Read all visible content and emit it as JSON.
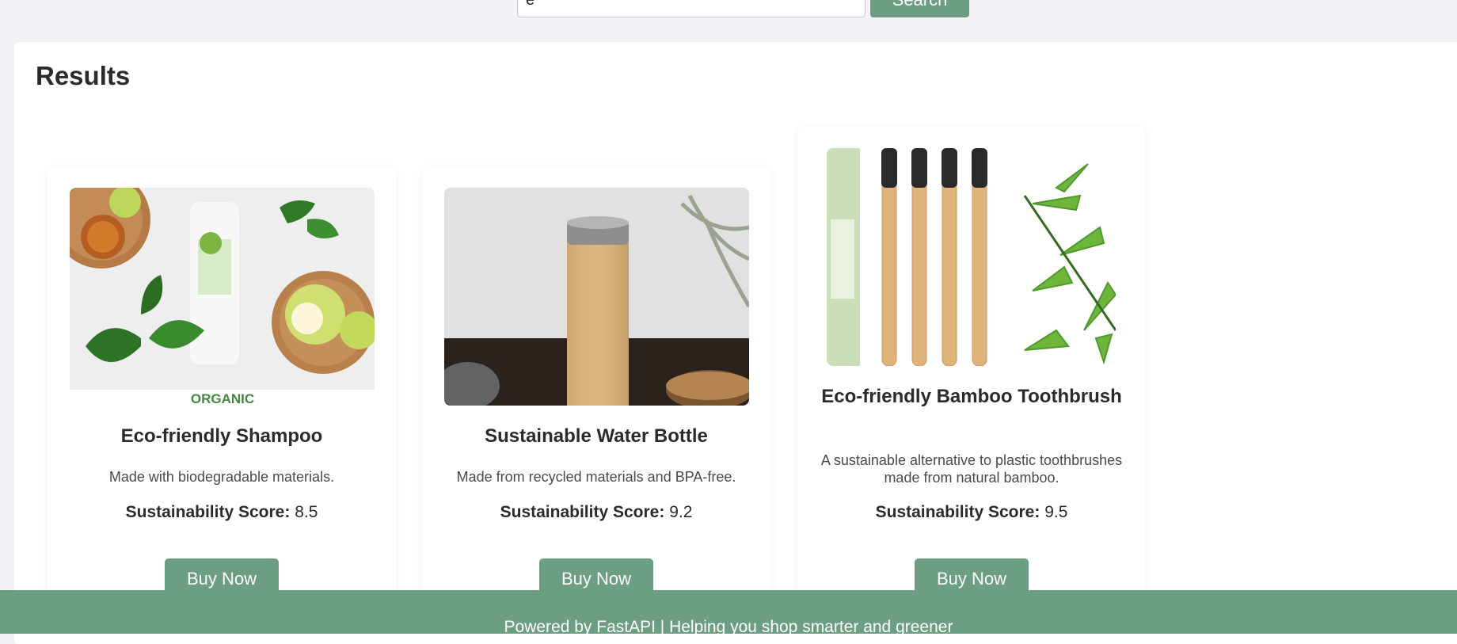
{
  "search": {
    "value": "e",
    "button_label": "Search"
  },
  "results": {
    "title": "Results",
    "score_label": "Sustainability Score:",
    "buy_label": "Buy Now",
    "products": [
      {
        "name": "Eco-friendly Shampoo",
        "description": "Made with biodegradable materials.",
        "score": "8.5",
        "image_label": "ORGANIC"
      },
      {
        "name": "Sustainable Water Bottle",
        "description": "Made from recycled materials and BPA-free.",
        "score": "9.2"
      },
      {
        "name": "Eco-friendly Bamboo Toothbrush",
        "description": "A sustainable alternative to plastic toothbrushes made from natural bamboo.",
        "score": "9.5"
      }
    ]
  },
  "footer": {
    "text": "Powered by FastAPI | Helping you shop smarter and greener"
  },
  "colors": {
    "accent": "#6c9e84",
    "page_background": "#f2f2f7",
    "card_background": "#ffffff"
  }
}
